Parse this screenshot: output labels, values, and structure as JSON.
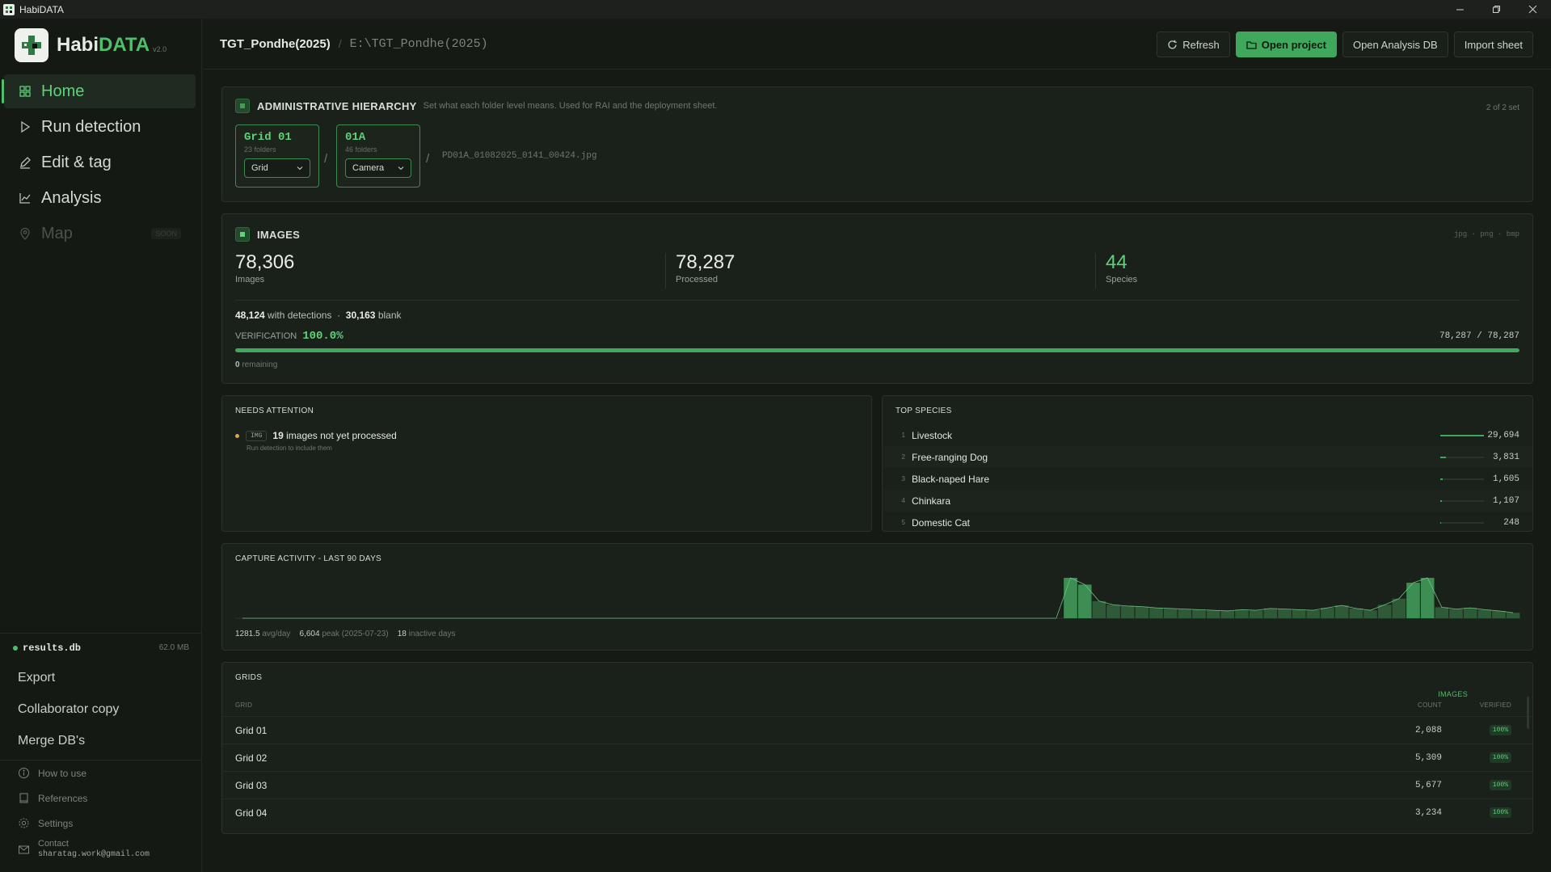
{
  "window": {
    "title": "HabiDATA"
  },
  "brand": {
    "name_a": "Habi",
    "name_b": "DATA",
    "version": "v2.0"
  },
  "nav": [
    {
      "label": "Home",
      "icon": "grid-icon",
      "active": true
    },
    {
      "label": "Run detection",
      "icon": "play-icon"
    },
    {
      "label": "Edit & tag",
      "icon": "pencil-icon"
    },
    {
      "label": "Analysis",
      "icon": "chart-line-icon"
    },
    {
      "label": "Map",
      "icon": "map-pin-icon",
      "badge": "SOON",
      "disabled": true
    }
  ],
  "database": {
    "name": "results.db",
    "size": "62.0 MB"
  },
  "sidebar_actions": [
    "Export",
    "Collaborator copy",
    "Merge DB's"
  ],
  "sidebar_links": [
    {
      "label": "How to use",
      "icon": "info-icon"
    },
    {
      "label": "References",
      "icon": "book-icon"
    },
    {
      "label": "Settings",
      "icon": "gear-icon"
    }
  ],
  "contact": {
    "label": "Contact",
    "email": "sharatag.work@gmail.com"
  },
  "header": {
    "project": "TGT_Pondhe(2025)",
    "separator": "/",
    "path": "E:\\TGT_Pondhe(2025)",
    "buttons": {
      "refresh": "Refresh",
      "open_project": "Open project",
      "open_db": "Open Analysis DB",
      "import_sheet": "Import sheet"
    }
  },
  "hierarchy": {
    "title": "ADMINISTRATIVE HIERARCHY",
    "desc": "Set what each folder level means. Used for RAI and the deployment sheet.",
    "count": "2 of 2 set",
    "levels": [
      {
        "name": "Grid 01",
        "sub": "23 folders",
        "select": "Grid"
      },
      {
        "name": "01A",
        "sub": "46 folders",
        "select": "Camera"
      }
    ],
    "file": "PD01A_01082025_0141_00424.jpg"
  },
  "images": {
    "title": "IMAGES",
    "formats": "jpg · png · bmp",
    "stats": [
      {
        "value": "78,306",
        "label": "Images"
      },
      {
        "value": "78,287",
        "label": "Processed"
      },
      {
        "value": "44",
        "label": "Species"
      }
    ],
    "with_detections": "48,124",
    "with_detections_label": "with detections",
    "blank": "30,163",
    "blank_label": "blank",
    "verification_label": "VERIFICATION",
    "verification_pct": "100.0%",
    "verification_fraction": 1.0,
    "verification_count": "78,287 / 78,287",
    "remaining": "0",
    "remaining_label": "remaining"
  },
  "attention": {
    "title": "NEEDS ATTENTION",
    "badge": "IMG",
    "count": "19",
    "text": "images not yet processed",
    "sub": "Run detection to include them"
  },
  "species": {
    "title": "TOP SPECIES",
    "items": [
      {
        "rank": "1",
        "name": "Livestock",
        "count": "29,694",
        "share": 1.0
      },
      {
        "rank": "2",
        "name": "Free-ranging Dog",
        "count": "3,831",
        "share": 0.129
      },
      {
        "rank": "3",
        "name": "Black-naped Hare",
        "count": "1,605",
        "share": 0.054
      },
      {
        "rank": "4",
        "name": "Chinkara",
        "count": "1,107",
        "share": 0.037
      },
      {
        "rank": "5",
        "name": "Domestic Cat",
        "count": "248",
        "share": 0.008
      }
    ]
  },
  "activity": {
    "title": "CAPTURE ACTIVITY - LAST 90 DAYS",
    "avg": "1281.5",
    "avg_label": "avg/day",
    "peak": "6,604",
    "peak_label": "peak (2025-07-23)",
    "inactive": "18",
    "inactive_label": "inactive days"
  },
  "chart_data": {
    "type": "bar",
    "title": "CAPTURE ACTIVITY - LAST 90 DAYS",
    "x": "day index (last 90 days)",
    "values": [
      0,
      0,
      0,
      0,
      0,
      0,
      0,
      0,
      0,
      0,
      0,
      0,
      0,
      0,
      0,
      0,
      0,
      0,
      0,
      0,
      0,
      0,
      0,
      0,
      0,
      0,
      0,
      0,
      0,
      0,
      0,
      0,
      0,
      0,
      0,
      0,
      0,
      0,
      0,
      0,
      0,
      0,
      0,
      0,
      0,
      0,
      0,
      0,
      0,
      0,
      0,
      0,
      0,
      0,
      0,
      0,
      0,
      0,
      6604,
      5500,
      2800,
      2200,
      2000,
      1900,
      1700,
      1600,
      1500,
      1400,
      1300,
      1200,
      1400,
      1300,
      1600,
      1500,
      1400,
      1300,
      1700,
      2100,
      1600,
      1300,
      2200,
      3200,
      5800,
      6600,
      1800,
      1500,
      1700,
      1400,
      1200,
      900
    ]
  },
  "grids": {
    "title": "GRIDS",
    "col_images": "IMAGES",
    "col_grid": "GRID",
    "col_count": "COUNT",
    "col_verified": "VERIFIED",
    "rows": [
      {
        "name": "Grid 01",
        "count": "2,088",
        "verified": "100%"
      },
      {
        "name": "Grid 02",
        "count": "5,309",
        "verified": "100%"
      },
      {
        "name": "Grid 03",
        "count": "5,677",
        "verified": "100%"
      },
      {
        "name": "Grid 04",
        "count": "3,234",
        "verified": "100%"
      }
    ]
  },
  "colors": {
    "accent": "#4fbf6a",
    "background": "#151a15",
    "card": "#1a201a",
    "warning": "#e0a63a"
  }
}
